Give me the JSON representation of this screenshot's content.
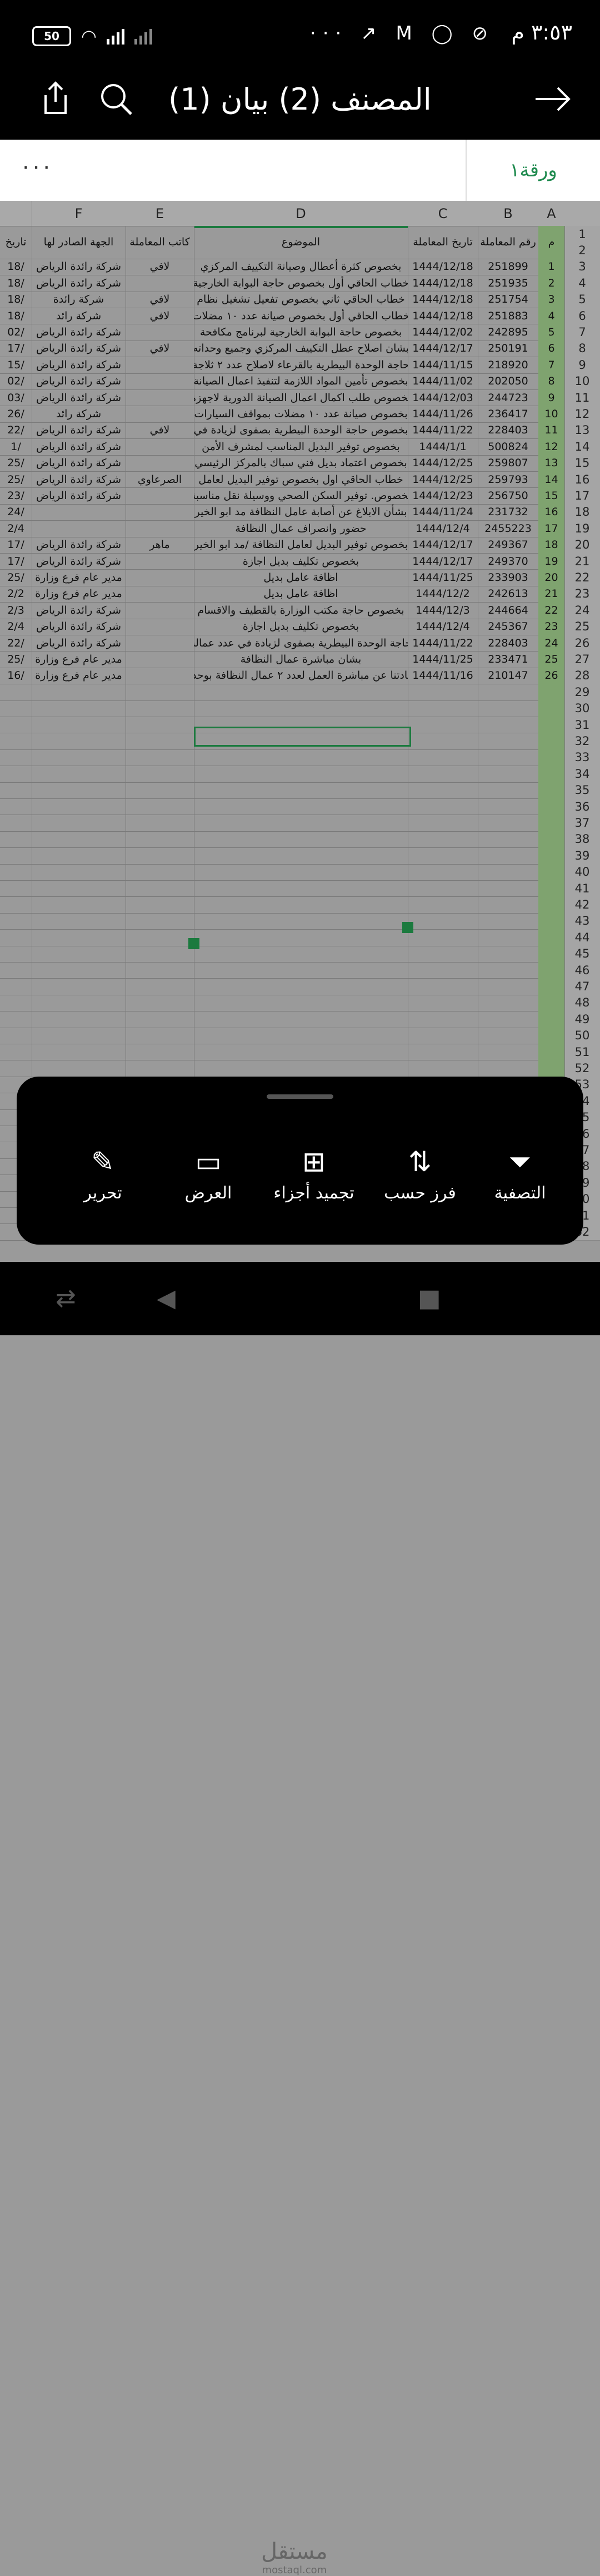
{
  "status_bar": {
    "time": "٣:٥٣ م",
    "battery": "50",
    "right_icons": [
      "mute-icon",
      "whatsapp-icon",
      "mail-icon",
      "trend-icon"
    ],
    "more": "···"
  },
  "app_bar": {
    "title": "المصنف (2) بيان (1)",
    "back_icon": "arrow-right",
    "search_icon": "search",
    "share_icon": "share"
  },
  "sheet_tabs": {
    "active": "ورقة١",
    "more": "···"
  },
  "columns": [
    "A",
    "B",
    "C",
    "D",
    "E",
    "F"
  ],
  "headers": {
    "A": "م",
    "B": "رقم المعاملة",
    "C": "تاريخ المعاملة",
    "D": "الموضوع",
    "E": "كاتب المعاملة",
    "F": "الجهة الصادر لها",
    "G": "تاريخ"
  },
  "rows": [
    {
      "rn": "3",
      "m": "1",
      "b": "251899",
      "c": "1444/12/18",
      "d": "بخصوص كثرة أعطال وصيانة التكييف المركزي",
      "e": "لافي",
      "f": "شركة رائدة الرياض",
      "g": "/18"
    },
    {
      "rn": "4",
      "m": "2",
      "b": "251935",
      "c": "1444/12/18",
      "d": "خطاب الحاقي أول بخصوص حاجة البوابة الخارجية",
      "e": "",
      "f": "شركة رائدة الرياض",
      "g": "/18"
    },
    {
      "rn": "5",
      "m": "3",
      "b": "251754",
      "c": "1444/12/18",
      "d": "خطاب الحاقي ثاني بخصوص تفعيل تشغيل نظام",
      "e": "لافي",
      "f": "شركة رائدة",
      "g": "/18"
    },
    {
      "rn": "6",
      "m": "4",
      "b": "251883",
      "c": "1444/12/18",
      "d": "خطاب الحاقي أول بخصوص صيانة عدد ١٠ مضلات",
      "e": "لافي",
      "f": "شركة رائد",
      "g": "/18"
    },
    {
      "rn": "7",
      "m": "5",
      "b": "242895",
      "c": "1444/12/02",
      "d": "بخصوص حاجة البوابة الخارجية لبرنامج مكافحة",
      "e": "",
      "f": "شركة رائدة الرياض",
      "g": "/02"
    },
    {
      "rn": "8",
      "m": "6",
      "b": "250191",
      "c": "1444/12/17",
      "d": "بشان اصلاح عطل التكييف المركزي وجميع وحداته",
      "e": "لافي",
      "f": "شركة رائدة الرياض",
      "g": "/17"
    },
    {
      "rn": "9",
      "m": "7",
      "b": "218920",
      "c": "1444/11/15",
      "d": "حاجة الوحدة البيطرية بالقرعاء لاصلاح عدد ٢ ثلاجة",
      "e": "",
      "f": "شركة رائدة الرياض",
      "g": "/15"
    },
    {
      "rn": "10",
      "m": "8",
      "b": "202050",
      "c": "1444/11/02",
      "d": "بخصوص تأمين المواد اللازمة لتنفيذ اعمال الصيانة",
      "e": "",
      "f": "شركة رائدة الرياض",
      "g": "/02"
    },
    {
      "rn": "11",
      "m": "9",
      "b": "244723",
      "c": "1444/12/03",
      "d": "بخصوص طلب اكمال اعمال الصيانة الدورية لاجهزة",
      "e": "",
      "f": "شركة رائدة الرياض",
      "g": "/03"
    },
    {
      "rn": "12",
      "m": "10",
      "b": "236417",
      "c": "1444/11/26",
      "d": "بخصوص صيانة عدد ١٠ مضلات بمواقف السيارات",
      "e": "",
      "f": "شركة رائد",
      "g": "/26"
    },
    {
      "rn": "13",
      "m": "11",
      "b": "228403",
      "c": "1444/11/22",
      "d": "بخصوص حاجة الوحدة البيطرية بصفوى لزيادة في",
      "e": "لافي",
      "f": "شركة رائدة الرياض",
      "g": "/22"
    },
    {
      "rn": "14",
      "m": "12",
      "b": "500824",
      "c": "1444/1/1",
      "d": "بخصوص توفير البديل المناسب لمشرف الأمن",
      "e": "",
      "f": "شركة رائدة الرياض",
      "g": "/1"
    },
    {
      "rn": "15",
      "m": "13",
      "b": "259807",
      "c": "1444/12/25",
      "d": "بخصوص اعتماد بديل فني سباك بالمركز الرئيسي",
      "e": "",
      "f": "شركة رائدة الرياض",
      "g": "/25"
    },
    {
      "rn": "16",
      "m": "14",
      "b": "259793",
      "c": "1444/12/25",
      "d": "خطاب الحاقي اول بخصوص توفير البديل لعامل",
      "e": "الصرعاوي",
      "f": "شركة رائدة الرياض",
      "g": "/25"
    },
    {
      "rn": "17",
      "m": "15",
      "b": "256750",
      "c": "1444/12/23",
      "d": "بخصوص. توفير السكن الصحي ووسيلة نقل مناسبة",
      "e": "",
      "f": "شركة رائدة الرياض",
      "g": "/23"
    },
    {
      "rn": "18",
      "m": "16",
      "b": "231732",
      "c": "1444/11/24",
      "d": "بشأن الابلاغ عن أصابة عامل النظافة مد ابو الخير",
      "e": "",
      "f": "",
      "g": "/24"
    },
    {
      "rn": "19",
      "m": "17",
      "b": "2455223",
      "c": "1444/12/4",
      "d": "حضور وانصراف عمال النظافة",
      "e": "",
      "f": "",
      "g": "2/4"
    },
    {
      "rn": "20",
      "m": "18",
      "b": "249367",
      "c": "1444/12/17",
      "d": "بخصوص توفير البديل لعامل النظافة /مد ابو الخير",
      "e": "ماهر",
      "f": "شركة رائدة الرياض",
      "g": "/17"
    },
    {
      "rn": "21",
      "m": "19",
      "b": "249370",
      "c": "1444/12/17",
      "d": "بخصوص تكليف بديل اجازة",
      "e": "",
      "f": "شركة رائدة الرياض",
      "g": "/17"
    },
    {
      "rn": "22",
      "m": "20",
      "b": "233903",
      "c": "1444/11/25",
      "d": "اظافة عامل بديل",
      "e": "",
      "f": "مدير عام فرع وزارة",
      "g": "/25"
    },
    {
      "rn": "23",
      "m": "21",
      "b": "242613",
      "c": "1444/12/2",
      "d": "اظافة عامل بديل",
      "e": "",
      "f": "مدير عام فرع وزارة",
      "g": "2/2"
    },
    {
      "rn": "24",
      "m": "22",
      "b": "244664",
      "c": "1444/12/3",
      "d": "بخصوص حاجة مكتب الوزارة بالقطيف والاقسام",
      "e": "",
      "f": "شركة رائدة الرياض",
      "g": "2/3"
    },
    {
      "rn": "25",
      "m": "23",
      "b": "245367",
      "c": "1444/12/4",
      "d": "بخصوص تكليف بديل اجازة",
      "e": "",
      "f": "شركة رائدة الرياض",
      "g": "2/4"
    },
    {
      "rn": "26",
      "m": "24",
      "b": "228403",
      "c": "1444/11/22",
      "d": "حاجة الوحدة البيطرية بصفوى لزيادة في عدد عمالة",
      "e": "",
      "f": "شركة رائدة الرياض",
      "g": "/22"
    },
    {
      "rn": "27",
      "m": "25",
      "b": "233471",
      "c": "1444/11/25",
      "d": "بشان مباشرة عمال النظافة",
      "e": "",
      "f": "مدير عام فرع وزارة",
      "g": "/25"
    },
    {
      "rn": "28",
      "m": "26",
      "b": "210147",
      "c": "1444/11/16",
      "d": "افادتنا عن مباشرة العمل لعدد ٢ عمال النظافة بوحدة",
      "e": "",
      "f": "مدير عام فرع وزارة",
      "g": "/16"
    }
  ],
  "empty_row_numbers": [
    "29",
    "30",
    "31",
    "32",
    "33",
    "34",
    "35",
    "36",
    "37",
    "38",
    "39",
    "40",
    "41",
    "42",
    "43",
    "44",
    "45",
    "46",
    "47",
    "48",
    "49",
    "50",
    "51",
    "52",
    "53",
    "54",
    "55",
    "56",
    "57",
    "58",
    "59",
    "60",
    "61",
    "62"
  ],
  "actions": [
    {
      "label": "التصفية",
      "icon": "filter-icon",
      "glyph": "⏷"
    },
    {
      "label": "فرز حسب",
      "icon": "sort-icon",
      "glyph": "⇅"
    },
    {
      "label": "تجميد أجزاء",
      "icon": "freeze-panes-icon",
      "glyph": "⊞"
    },
    {
      "label": "العرض",
      "icon": "display-icon",
      "glyph": "▭"
    },
    {
      "label": "تحرير",
      "icon": "edit-icon",
      "glyph": "✎"
    }
  ],
  "watermark": {
    "text": "مستقل",
    "sub": "mostaql.com"
  }
}
